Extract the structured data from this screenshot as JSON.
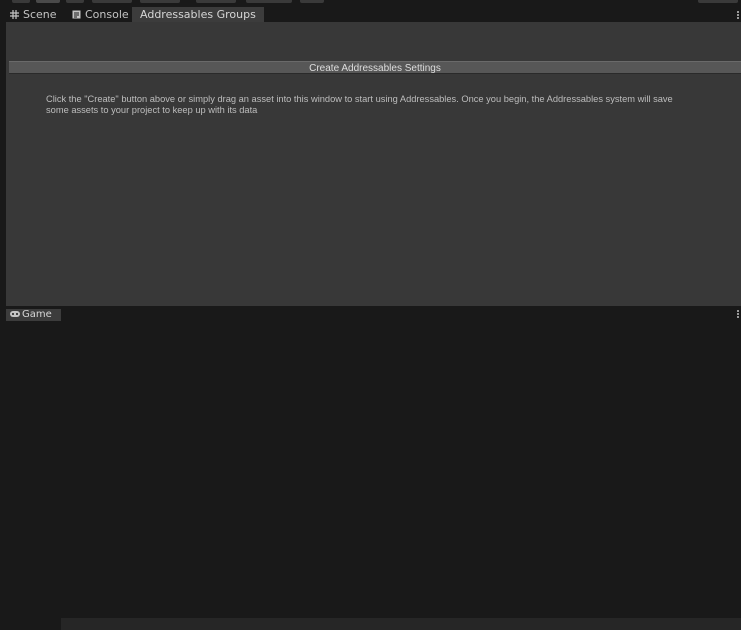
{
  "tabs": [
    {
      "label": "Scene",
      "icon": "grid-icon",
      "active": false
    },
    {
      "label": "Console",
      "icon": "console-icon",
      "active": false
    },
    {
      "label": "Addressables Groups",
      "active": true
    }
  ],
  "addressables": {
    "create_button_label": "Create Addressables Settings",
    "message_line1": "Click the \"Create\" button above or simply drag an asset into this window to start using Addressables.  Once you begin, the Addressables system will save",
    "message_line2": "some assets to your project to keep up with its data"
  },
  "bottom_tabs": [
    {
      "label": "Game",
      "icon": "gamepad-icon"
    }
  ],
  "colors": {
    "background": "#191919",
    "panel": "#383838",
    "button": "#575757",
    "text": "#c4c4c4"
  }
}
